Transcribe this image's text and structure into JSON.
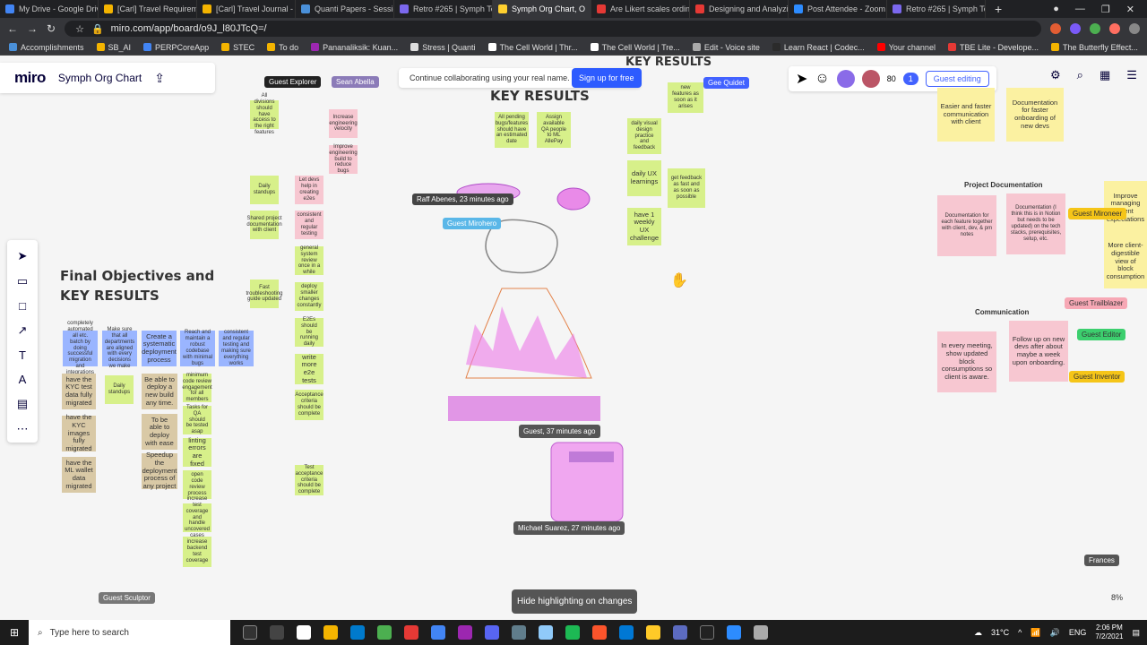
{
  "browser": {
    "tabs": [
      {
        "title": "My Drive - Google Drive",
        "color": "#4285f4"
      },
      {
        "title": "[Carl] Travel Requireme",
        "color": "#f4b400"
      },
      {
        "title": "[Carl] Travel Journal - Gr",
        "color": "#f4b400"
      },
      {
        "title": "Quanti Papers - Session",
        "color": "#4a90d9"
      },
      {
        "title": "Retro #265 | Symph Tea",
        "color": "#7b68ee"
      },
      {
        "title": "Symph Org Chart, O",
        "color": "#ffd02f",
        "active": true
      },
      {
        "title": "Are Likert scales ordinal",
        "color": "#e53935"
      },
      {
        "title": "Designing and Analyzing",
        "color": "#e53935"
      },
      {
        "title": "Post Attendee - Zoom",
        "color": "#2d8cff"
      },
      {
        "title": "Retro #265 | Symph Tea",
        "color": "#7b68ee"
      }
    ],
    "new_tab": "+",
    "url": "miro.com/app/board/o9J_l80JTcQ=/",
    "bookmarks": [
      "Accomplishments",
      "SB_AI",
      "PERPCoreApp",
      "STEC",
      "To do",
      "Pananaliksik: Kuan...",
      "Stress | Quanti",
      "The Cell World | Thr...",
      "The Cell World | Tre...",
      "Edit - Voice site",
      "Learn React | Codec...",
      "Your channel",
      "TBE Lite - Develope...",
      "The Butterfly Effect..."
    ]
  },
  "miro": {
    "logo": "miro",
    "board_name": "Symph Org Chart",
    "banner_text": "Continue collaborating using your real name.",
    "signup_label": "Sign up for free",
    "guest_editing": "Guest editing",
    "collab_count": "80",
    "hand_count": "1",
    "hide_highlight": "Hide highlighting on changes"
  },
  "board": {
    "heading_final": "Final Objectives and\nKEY RESULTS",
    "heading_kr": "KEY RESULTS",
    "heading_kr_top": "KEY RESULTS",
    "section_project_doc": "Project Documentation",
    "section_communication": "Communication",
    "stickies": {
      "blue1": "completely automated all etc. batch by doing successful migration and integrations",
      "blue2": "Make sure that all departments are aligned with every decisions we make",
      "blue3": "Create a systematic deployment process",
      "blue4": "Reach and maintain a robust codebase with minimal bugs",
      "blue5": "consistent and regular testing and making sure everything works",
      "tan1": "have the KYC test data fully migrated",
      "tan2": "have the KYC images fully migrated",
      "tan3": "have the ML wallet data migrated",
      "tan4": "Be able to deploy a new build any time.",
      "tan5": "To be able to deploy with ease",
      "tan6": "Speedup the deployment process of any project",
      "g_mid1": "minimum code review engagement for all members",
      "g_mid2": "Tasks for QA should be tested asap",
      "g_mid3": "linting errors are fixed",
      "g_mid4": "open code review process",
      "g_mid5": "increase test coverage and handle uncovered cases",
      "g_mid6": "increase backend test coverage",
      "g_ac1": "Assign available QA people to ML AllePay",
      "g_ac2": "All pending bugs/features should have an estimated date",
      "g_ux1": "daily visual design practice and feedback",
      "g_ux2": "daily UX learnings",
      "g_ux3": "have 1 weekly UX challenge",
      "g_ux4": "get feedback as fast and as soon as possible",
      "g_ux5": "new features as soon as it arises",
      "g_col1": "All divisions should have access to the right features",
      "g_col2": "Daily standups",
      "g_col3": "Shared project documentation with client",
      "g_col4": "Fast troubleshooting guide updated",
      "p_col1": "Increase engineering velocity",
      "p_col2": "Improve engineering build to reduce bugs",
      "p_col3": "Let devs help in creating e2es",
      "p_col4": "consistent and regular testing",
      "g_col5": "general system review once in a while",
      "g_col6": "deploy smaller changes constantly",
      "g_col7": "E2Es should be running daily",
      "g_col8": "write more e2e tests",
      "g_col9": "Acceptance criteria should be complete",
      "g_col10": "Test acceptance criteria should be complete",
      "y_right1": "Easier and faster communication with client",
      "y_right2": "Documentation for faster onboarding of new devs",
      "p_doc1": "Documentation for each feature together with client, dev, & pm notes",
      "p_doc2": "Documentation (I think this is in Notion but needs to be updated) on the tech stacks, prerequisites, setup, etc.",
      "p_com1": "In every meeting, show updated block consumptions so client is aware.",
      "p_com2": "Follow up on new devs after about maybe a week upon onboarding.",
      "y_far1": "Improve managing client expectations",
      "y_far2": "More client-digestible view of block consumption"
    }
  },
  "cursors": {
    "raff": "Raff Abenes, 23 minutes ago",
    "guest_mirohero": "Guest Mirohero",
    "guest_37": "Guest, 37 minutes ago",
    "michael": "Michael Suarez, 27 minutes ago",
    "guest_explorer": "Guest Explorer",
    "sean": "Sean Abella",
    "gee_quidet": "Gee Quidet",
    "guest_mironeer": "Guest Mironeer",
    "guest_trailblazer": "Guest Trailblazer",
    "guest_editor": "Guest Editor",
    "guest_inventor": "Guest Inventor",
    "guest_sculptor": "Guest Sculptor",
    "frances": "Frances",
    "percent": "8%"
  },
  "taskbar": {
    "search_placeholder": "Type here to search",
    "temperature": "31°C",
    "lang": "ENG",
    "time": "2:06 PM",
    "date": "7/2/2021"
  }
}
